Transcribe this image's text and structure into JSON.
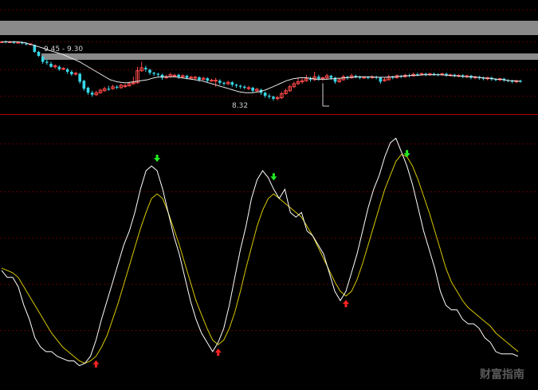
{
  "watermark": "财富指南",
  "colors": {
    "background": "#000000",
    "grid": "#7a0000",
    "divider": "#b00000",
    "bull": "#ff4a4a",
    "bear": "#37d7e8",
    "ma_line": "#e8e8e8",
    "k_line": "#ffffff",
    "d_line": "#d8c800",
    "buy_arrow": "#ff2222",
    "sell_arrow": "#22ee22",
    "band": "#8a8a8a",
    "label_text": "#d0d0d0"
  },
  "chart_data": [
    {
      "type": "candlestick",
      "panel": "price",
      "annotations": [
        {
          "text": "9.45 - 9.30",
          "kind": "range"
        },
        {
          "text": "8.32",
          "kind": "low-marker",
          "at_index": 78
        }
      ],
      "ylim": [
        8.1,
        9.7
      ],
      "ma": [
        9.5,
        9.5,
        9.5,
        9.5,
        9.5,
        9.5,
        9.49,
        9.48,
        9.46,
        9.44,
        9.42,
        9.4,
        9.38,
        9.35,
        9.33,
        9.31,
        9.29,
        9.27,
        9.25,
        9.22,
        9.19,
        9.16,
        9.13,
        9.1,
        9.06,
        9.02,
        8.98,
        8.94,
        8.9,
        8.86,
        8.82,
        8.78,
        8.74,
        8.72,
        8.7,
        8.69,
        8.68,
        8.68,
        8.69,
        8.7,
        8.71,
        8.72,
        8.73,
        8.74,
        8.76,
        8.78,
        8.79,
        8.8,
        8.8,
        8.8,
        8.8,
        8.8,
        8.79,
        8.78,
        8.77,
        8.76,
        8.75,
        8.74,
        8.73,
        8.72,
        8.7,
        8.68,
        8.66,
        8.64,
        8.62,
        8.6,
        8.58,
        8.56,
        8.54,
        8.52,
        8.5,
        8.49,
        8.48,
        8.48,
        8.48,
        8.49,
        8.5,
        8.52,
        8.54,
        8.57,
        8.6,
        8.63,
        8.66,
        8.69,
        8.72,
        8.74,
        8.76,
        8.77,
        8.78,
        8.78,
        8.78,
        8.77,
        8.76,
        8.75,
        8.75,
        8.75,
        8.75,
        8.76,
        8.76,
        8.77,
        8.77,
        8.78,
        8.78,
        8.79,
        8.79,
        8.8,
        8.8,
        8.8,
        8.8,
        8.8,
        8.79,
        8.79,
        8.79,
        8.79,
        8.79,
        8.8,
        8.8,
        8.81,
        8.81,
        8.82,
        8.82,
        8.83,
        8.83,
        8.83,
        8.84,
        8.84,
        8.84,
        8.84,
        8.84,
        8.84,
        8.84,
        8.83,
        8.83,
        8.82,
        8.82,
        8.81,
        8.81,
        8.8,
        8.8,
        8.8,
        8.79,
        8.78,
        8.78,
        8.77,
        8.77,
        8.76,
        8.75,
        8.75,
        8.74,
        8.73,
        8.72,
        8.72,
        8.71,
        8.71
      ],
      "candles": [
        {
          "o": 9.5,
          "c": 9.5,
          "h": 9.52,
          "l": 9.48
        },
        {
          "o": 9.51,
          "c": 9.49,
          "h": 9.53,
          "l": 9.47
        },
        {
          "o": 9.49,
          "c": 9.5,
          "h": 9.52,
          "l": 9.48
        },
        {
          "o": 9.5,
          "c": 9.48,
          "h": 9.52,
          "l": 9.46
        },
        {
          "o": 9.48,
          "c": 9.49,
          "h": 9.51,
          "l": 9.47
        },
        {
          "o": 9.49,
          "c": 9.47,
          "h": 9.51,
          "l": 9.45
        },
        {
          "o": 9.47,
          "c": 9.45,
          "h": 9.49,
          "l": 9.43
        },
        {
          "o": 9.45,
          "c": 9.46,
          "h": 9.47,
          "l": 9.43
        },
        {
          "o": 9.44,
          "c": 9.3,
          "h": 9.45,
          "l": 9.28
        },
        {
          "o": 9.3,
          "c": 9.22,
          "h": 9.32,
          "l": 9.2
        },
        {
          "o": 9.2,
          "c": 9.1,
          "h": 9.22,
          "l": 9.06
        },
        {
          "o": 9.1,
          "c": 9.08,
          "h": 9.15,
          "l": 9.04
        },
        {
          "o": 9.06,
          "c": 9.0,
          "h": 9.1,
          "l": 8.98
        },
        {
          "o": 9.0,
          "c": 9.02,
          "h": 9.05,
          "l": 8.96
        },
        {
          "o": 9.0,
          "c": 8.95,
          "h": 9.03,
          "l": 8.92
        },
        {
          "o": 8.96,
          "c": 8.97,
          "h": 8.99,
          "l": 8.93
        },
        {
          "o": 8.95,
          "c": 8.9,
          "h": 8.98,
          "l": 8.86
        },
        {
          "o": 8.9,
          "c": 8.85,
          "h": 8.93,
          "l": 8.82
        },
        {
          "o": 8.86,
          "c": 8.87,
          "h": 8.9,
          "l": 8.82
        },
        {
          "o": 8.86,
          "c": 8.7,
          "h": 8.88,
          "l": 8.66
        },
        {
          "o": 8.72,
          "c": 8.56,
          "h": 8.74,
          "l": 8.52
        },
        {
          "o": 8.58,
          "c": 8.48,
          "h": 8.6,
          "l": 8.44
        },
        {
          "o": 8.48,
          "c": 8.44,
          "h": 8.52,
          "l": 8.4
        },
        {
          "o": 8.44,
          "c": 8.48,
          "h": 8.52,
          "l": 8.42
        },
        {
          "o": 8.48,
          "c": 8.53,
          "h": 8.56,
          "l": 8.46
        },
        {
          "o": 8.52,
          "c": 8.56,
          "h": 8.6,
          "l": 8.5
        },
        {
          "o": 8.56,
          "c": 8.54,
          "h": 8.62,
          "l": 8.52
        },
        {
          "o": 8.56,
          "c": 8.6,
          "h": 8.64,
          "l": 8.54
        },
        {
          "o": 8.6,
          "c": 8.58,
          "h": 8.63,
          "l": 8.55
        },
        {
          "o": 8.58,
          "c": 8.63,
          "h": 8.66,
          "l": 8.56
        },
        {
          "o": 8.62,
          "c": 8.62,
          "h": 8.66,
          "l": 8.58
        },
        {
          "o": 8.62,
          "c": 8.66,
          "h": 8.7,
          "l": 8.6
        },
        {
          "o": 8.66,
          "c": 8.68,
          "h": 8.8,
          "l": 8.64
        },
        {
          "o": 8.68,
          "c": 8.92,
          "h": 9.0,
          "l": 8.66
        },
        {
          "o": 8.92,
          "c": 8.98,
          "h": 9.1,
          "l": 8.9
        },
        {
          "o": 8.98,
          "c": 8.95,
          "h": 9.02,
          "l": 8.9
        },
        {
          "o": 8.94,
          "c": 8.88,
          "h": 8.96,
          "l": 8.84
        },
        {
          "o": 8.88,
          "c": 8.86,
          "h": 8.9,
          "l": 8.82
        },
        {
          "o": 8.86,
          "c": 8.84,
          "h": 8.88,
          "l": 8.8
        },
        {
          "o": 8.84,
          "c": 8.78,
          "h": 8.86,
          "l": 8.74
        },
        {
          "o": 8.78,
          "c": 8.8,
          "h": 8.84,
          "l": 8.76
        },
        {
          "o": 8.8,
          "c": 8.84,
          "h": 8.88,
          "l": 8.78
        },
        {
          "o": 8.83,
          "c": 8.83,
          "h": 8.86,
          "l": 8.79
        },
        {
          "o": 8.84,
          "c": 8.8,
          "h": 8.86,
          "l": 8.76
        },
        {
          "o": 8.8,
          "c": 8.82,
          "h": 8.85,
          "l": 8.77
        },
        {
          "o": 8.82,
          "c": 8.78,
          "h": 8.84,
          "l": 8.75
        },
        {
          "o": 8.78,
          "c": 8.79,
          "h": 8.82,
          "l": 8.76
        },
        {
          "o": 8.79,
          "c": 8.79,
          "h": 8.82,
          "l": 8.75
        },
        {
          "o": 8.79,
          "c": 8.74,
          "h": 8.81,
          "l": 8.7
        },
        {
          "o": 8.75,
          "c": 8.77,
          "h": 8.8,
          "l": 8.73
        },
        {
          "o": 8.77,
          "c": 8.72,
          "h": 8.79,
          "l": 8.68
        },
        {
          "o": 8.72,
          "c": 8.73,
          "h": 8.76,
          "l": 8.7
        },
        {
          "o": 8.73,
          "c": 8.73,
          "h": 8.78,
          "l": 8.6
        },
        {
          "o": 8.72,
          "c": 8.68,
          "h": 8.75,
          "l": 8.64
        },
        {
          "o": 8.68,
          "c": 8.66,
          "h": 8.7,
          "l": 8.62
        },
        {
          "o": 8.66,
          "c": 8.69,
          "h": 8.72,
          "l": 8.63
        },
        {
          "o": 8.69,
          "c": 8.64,
          "h": 8.71,
          "l": 8.6
        },
        {
          "o": 8.64,
          "c": 8.62,
          "h": 8.66,
          "l": 8.58
        },
        {
          "o": 8.62,
          "c": 8.6,
          "h": 8.64,
          "l": 8.56
        },
        {
          "o": 8.6,
          "c": 8.58,
          "h": 8.63,
          "l": 8.55
        },
        {
          "o": 8.58,
          "c": 8.58,
          "h": 8.62,
          "l": 8.53
        },
        {
          "o": 8.58,
          "c": 8.52,
          "h": 8.6,
          "l": 8.48
        },
        {
          "o": 8.52,
          "c": 8.55,
          "h": 8.58,
          "l": 8.5
        },
        {
          "o": 8.54,
          "c": 8.48,
          "h": 8.56,
          "l": 8.44
        },
        {
          "o": 8.48,
          "c": 8.42,
          "h": 8.5,
          "l": 8.38
        },
        {
          "o": 8.42,
          "c": 8.4,
          "h": 8.46,
          "l": 8.36
        },
        {
          "o": 8.4,
          "c": 8.36,
          "h": 8.42,
          "l": 8.32
        },
        {
          "o": 8.36,
          "c": 8.38,
          "h": 8.42,
          "l": 8.33
        },
        {
          "o": 8.38,
          "c": 8.46,
          "h": 8.5,
          "l": 8.35
        },
        {
          "o": 8.46,
          "c": 8.52,
          "h": 8.56,
          "l": 8.44
        },
        {
          "o": 8.52,
          "c": 8.6,
          "h": 8.64,
          "l": 8.5
        },
        {
          "o": 8.6,
          "c": 8.66,
          "h": 8.7,
          "l": 8.58
        },
        {
          "o": 8.66,
          "c": 8.7,
          "h": 8.78,
          "l": 8.64
        },
        {
          "o": 8.7,
          "c": 8.72,
          "h": 8.76,
          "l": 8.66
        },
        {
          "o": 8.72,
          "c": 8.76,
          "h": 8.84,
          "l": 8.7
        },
        {
          "o": 8.76,
          "c": 8.74,
          "h": 8.8,
          "l": 8.7
        },
        {
          "o": 8.74,
          "c": 8.8,
          "h": 8.9,
          "l": 8.72
        },
        {
          "o": 8.8,
          "c": 8.76,
          "h": 8.84,
          "l": 8.72
        },
        {
          "o": 8.76,
          "c": 8.78,
          "h": 8.8,
          "l": 8.72
        },
        {
          "o": 8.78,
          "c": 8.82,
          "h": 8.86,
          "l": 8.75
        },
        {
          "o": 8.82,
          "c": 8.78,
          "h": 8.84,
          "l": 8.74
        },
        {
          "o": 8.78,
          "c": 8.7,
          "h": 8.8,
          "l": 8.66
        },
        {
          "o": 8.7,
          "c": 8.74,
          "h": 8.78,
          "l": 8.68
        },
        {
          "o": 8.74,
          "c": 8.8,
          "h": 8.84,
          "l": 8.72
        },
        {
          "o": 8.8,
          "c": 8.78,
          "h": 8.82,
          "l": 8.74
        },
        {
          "o": 8.78,
          "c": 8.82,
          "h": 8.86,
          "l": 8.76
        },
        {
          "o": 8.82,
          "c": 8.8,
          "h": 8.84,
          "l": 8.77
        },
        {
          "o": 8.8,
          "c": 8.78,
          "h": 8.82,
          "l": 8.75
        },
        {
          "o": 8.78,
          "c": 8.79,
          "h": 8.81,
          "l": 8.76
        },
        {
          "o": 8.79,
          "c": 8.78,
          "h": 8.81,
          "l": 8.75
        },
        {
          "o": 8.78,
          "c": 8.8,
          "h": 8.83,
          "l": 8.76
        },
        {
          "o": 8.8,
          "c": 8.78,
          "h": 8.82,
          "l": 8.75
        },
        {
          "o": 8.78,
          "c": 8.7,
          "h": 8.8,
          "l": 8.66
        },
        {
          "o": 8.72,
          "c": 8.74,
          "h": 8.78,
          "l": 8.7
        },
        {
          "o": 8.74,
          "c": 8.8,
          "h": 8.84,
          "l": 8.72
        },
        {
          "o": 8.8,
          "c": 8.78,
          "h": 8.82,
          "l": 8.75
        },
        {
          "o": 8.78,
          "c": 8.82,
          "h": 8.85,
          "l": 8.76
        },
        {
          "o": 8.82,
          "c": 8.8,
          "h": 8.84,
          "l": 8.77
        },
        {
          "o": 8.8,
          "c": 8.83,
          "h": 8.86,
          "l": 8.78
        },
        {
          "o": 8.83,
          "c": 8.82,
          "h": 8.86,
          "l": 8.79
        },
        {
          "o": 8.82,
          "c": 8.85,
          "h": 8.88,
          "l": 8.8
        },
        {
          "o": 8.85,
          "c": 8.84,
          "h": 8.88,
          "l": 8.81
        },
        {
          "o": 8.84,
          "c": 8.86,
          "h": 8.89,
          "l": 8.82
        },
        {
          "o": 8.86,
          "c": 8.84,
          "h": 8.88,
          "l": 8.81
        },
        {
          "o": 8.84,
          "c": 8.86,
          "h": 8.88,
          "l": 8.82
        },
        {
          "o": 8.86,
          "c": 8.85,
          "h": 8.88,
          "l": 8.82
        },
        {
          "o": 8.85,
          "c": 8.84,
          "h": 8.87,
          "l": 8.81
        },
        {
          "o": 8.84,
          "c": 8.86,
          "h": 8.88,
          "l": 8.82
        },
        {
          "o": 8.86,
          "c": 8.83,
          "h": 8.88,
          "l": 8.8
        },
        {
          "o": 8.83,
          "c": 8.84,
          "h": 8.86,
          "l": 8.8
        },
        {
          "o": 8.84,
          "c": 8.82,
          "h": 8.86,
          "l": 8.79
        },
        {
          "o": 8.82,
          "c": 8.83,
          "h": 8.85,
          "l": 8.79
        },
        {
          "o": 8.83,
          "c": 8.8,
          "h": 8.85,
          "l": 8.77
        },
        {
          "o": 8.8,
          "c": 8.82,
          "h": 8.84,
          "l": 8.77
        },
        {
          "o": 8.82,
          "c": 8.78,
          "h": 8.84,
          "l": 8.75
        },
        {
          "o": 8.78,
          "c": 8.8,
          "h": 8.82,
          "l": 8.75
        },
        {
          "o": 8.8,
          "c": 8.78,
          "h": 8.82,
          "l": 8.74
        },
        {
          "o": 8.78,
          "c": 8.76,
          "h": 8.8,
          "l": 8.73
        },
        {
          "o": 8.76,
          "c": 8.78,
          "h": 8.8,
          "l": 8.73
        },
        {
          "o": 8.78,
          "c": 8.75,
          "h": 8.8,
          "l": 8.72
        },
        {
          "o": 8.75,
          "c": 8.74,
          "h": 8.77,
          "l": 8.71
        },
        {
          "o": 8.74,
          "c": 8.76,
          "h": 8.78,
          "l": 8.71
        },
        {
          "o": 8.76,
          "c": 8.73,
          "h": 8.78,
          "l": 8.7
        },
        {
          "o": 8.73,
          "c": 8.72,
          "h": 8.75,
          "l": 8.69
        },
        {
          "o": 8.72,
          "c": 8.7,
          "h": 8.74,
          "l": 8.67
        },
        {
          "o": 8.7,
          "c": 8.72,
          "h": 8.74,
          "l": 8.67
        },
        {
          "o": 8.72,
          "c": 8.7,
          "h": 8.74,
          "l": 8.68
        }
      ]
    },
    {
      "type": "line",
      "panel": "oscillator",
      "ylim": [
        0,
        110
      ],
      "series": [
        {
          "key": "k",
          "values": [
            45,
            42,
            42,
            38,
            30,
            24,
            16,
            12,
            10,
            10,
            8,
            7,
            6,
            6,
            4,
            5,
            8,
            15,
            24,
            32,
            40,
            48,
            56,
            62,
            70,
            80,
            88,
            90,
            88,
            80,
            70,
            60,
            52,
            42,
            32,
            24,
            18,
            14,
            10,
            14,
            20,
            30,
            42,
            54,
            64,
            76,
            84,
            88,
            85,
            80,
            76,
            80,
            70,
            68,
            70,
            62,
            60,
            56,
            52,
            44,
            36,
            32,
            36,
            44,
            52,
            62,
            72,
            80,
            86,
            94,
            100,
            102,
            96,
            90,
            82,
            72,
            62,
            54,
            46,
            36,
            30,
            28,
            28,
            24,
            22,
            22,
            20,
            16,
            14,
            10,
            9,
            9,
            9,
            8
          ]
        },
        {
          "key": "d",
          "values": [
            46,
            45,
            44,
            42,
            38,
            34,
            30,
            26,
            22,
            18,
            15,
            12,
            10,
            8,
            6,
            5,
            6,
            8,
            12,
            17,
            24,
            31,
            39,
            47,
            55,
            63,
            70,
            76,
            78,
            76,
            70,
            63,
            56,
            48,
            40,
            32,
            26,
            20,
            15,
            13,
            15,
            20,
            27,
            36,
            46,
            55,
            64,
            71,
            76,
            78,
            76,
            74,
            72,
            70,
            68,
            64,
            60,
            55,
            50,
            45,
            40,
            36,
            34,
            36,
            41,
            48,
            56,
            64,
            72,
            80,
            86,
            92,
            95,
            94,
            90,
            84,
            77,
            70,
            62,
            54,
            46,
            40,
            36,
            32,
            29,
            27,
            25,
            23,
            21,
            18,
            16,
            14,
            12,
            10
          ]
        }
      ],
      "signals": [
        {
          "kind": "sell",
          "at_index": 28
        },
        {
          "kind": "sell",
          "at_index": 49
        },
        {
          "kind": "sell",
          "at_index": 73
        },
        {
          "kind": "buy",
          "at_index": 17
        },
        {
          "kind": "buy",
          "at_index": 39
        },
        {
          "kind": "buy",
          "at_index": 62
        }
      ]
    }
  ]
}
